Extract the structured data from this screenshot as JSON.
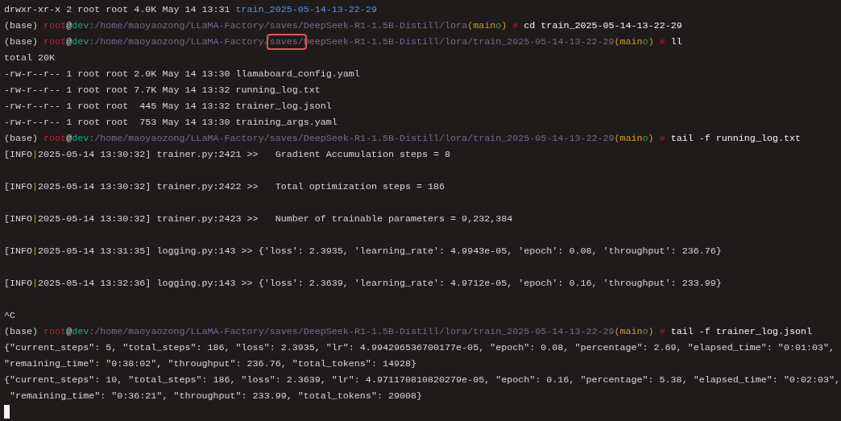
{
  "terminal": {
    "lines": [
      {
        "kind": "text",
        "segments": [
          {
            "text": "drwxr-xr-x 2 root root 4.0K May 14 13:31 ",
            "kind": "plain"
          },
          {
            "text": "train_2025-05-14-13-22-29",
            "kind": "dir"
          }
        ]
      },
      {
        "kind": "prompt",
        "env": "(base)",
        "user": "root",
        "at": "@",
        "host": "dev",
        "path": [
          {
            "text": ":/home/maoyaozong/LLaMA-Factory/saves/DeepSeek-R1-1.5B-Distill/lora",
            "boxed": false
          }
        ],
        "branch_open": "(",
        "branch": "main",
        "branch_mark": "o",
        "branch_close": ")",
        "symbol": "#",
        "command": "cd train_2025-05-14-13-22-29"
      },
      {
        "kind": "prompt",
        "env": "(base)",
        "user": "root",
        "at": "@",
        "host": "dev",
        "path": [
          {
            "text": ":/home/maoyaozong/LLaMA-Factory/",
            "boxed": false
          },
          {
            "text": "saves/",
            "boxed": true
          },
          {
            "text": "DeepSeek-R1-1.5B-Distill/lora/train_2025-05-14-13-22-29",
            "boxed": false
          }
        ],
        "branch_open": "(",
        "branch": "main",
        "branch_mark": "o",
        "branch_close": ")",
        "symbol": "#",
        "command": "ll"
      },
      {
        "kind": "text",
        "segments": [
          {
            "text": "total 20K",
            "kind": "plain"
          }
        ]
      },
      {
        "kind": "text",
        "segments": [
          {
            "text": "-rw-r--r-- 1 root root 2.0K May 14 13:30 llamaboard_config.yaml",
            "kind": "plain"
          }
        ]
      },
      {
        "kind": "text",
        "segments": [
          {
            "text": "-rw-r--r-- 1 root root 7.7K May 14 13:32 running_log.txt",
            "kind": "plain"
          }
        ]
      },
      {
        "kind": "text",
        "segments": [
          {
            "text": "-rw-r--r-- 1 root root  445 May 14 13:32 trainer_log.jsonl",
            "kind": "plain"
          }
        ]
      },
      {
        "kind": "text",
        "segments": [
          {
            "text": "-rw-r--r-- 1 root root  753 May 14 13:30 training_args.yaml",
            "kind": "plain"
          }
        ]
      },
      {
        "kind": "prompt",
        "env": "(base)",
        "user": "root",
        "at": "@",
        "host": "dev",
        "path": [
          {
            "text": ":/home/maoyaozong/LLaMA-Factory/saves/DeepSeek-R1-1.5B-Distill/lora/train_2025-05-14-13-22-29",
            "boxed": false
          }
        ],
        "branch_open": "(",
        "branch": "main",
        "branch_mark": "o",
        "branch_close": ")",
        "symbol": "#",
        "command": "tail -f running_log.txt"
      },
      {
        "kind": "text",
        "segments": [
          {
            "text": "[INFO",
            "kind": "plain"
          },
          {
            "text": "|",
            "kind": "accent"
          },
          {
            "text": "2025-05-14 13:30:32] trainer.py:2421 >>   Gradient Accumulation steps = 8",
            "kind": "plain"
          }
        ]
      },
      {
        "kind": "blank"
      },
      {
        "kind": "text",
        "segments": [
          {
            "text": "[INFO",
            "kind": "plain"
          },
          {
            "text": "|",
            "kind": "accent"
          },
          {
            "text": "2025-05-14 13:30:32] trainer.py:2422 >>   Total optimization steps = 186",
            "kind": "plain"
          }
        ]
      },
      {
        "kind": "blank"
      },
      {
        "kind": "text",
        "segments": [
          {
            "text": "[INFO",
            "kind": "plain"
          },
          {
            "text": "|",
            "kind": "accent"
          },
          {
            "text": "2025-05-14 13:30:32] trainer.py:2423 >>   Number of trainable parameters = 9,232,384",
            "kind": "plain"
          }
        ]
      },
      {
        "kind": "blank"
      },
      {
        "kind": "text",
        "segments": [
          {
            "text": "[INFO",
            "kind": "plain"
          },
          {
            "text": "|",
            "kind": "accent"
          },
          {
            "text": "2025-05-14 13:31:35] logging.py:143 >> {'loss': 2.3935, 'learning_rate': 4.9943e-05, 'epoch': 0.08, 'throughput': 236.76}",
            "kind": "plain"
          }
        ]
      },
      {
        "kind": "blank"
      },
      {
        "kind": "text",
        "segments": [
          {
            "text": "[INFO",
            "kind": "plain"
          },
          {
            "text": "|",
            "kind": "accent"
          },
          {
            "text": "2025-05-14 13:32:36] logging.py:143 >> {'loss': 2.3639, 'learning_rate': 4.9712e-05, 'epoch': 0.16, 'throughput': 233.99}",
            "kind": "plain"
          }
        ]
      },
      {
        "kind": "blank"
      },
      {
        "kind": "text",
        "segments": [
          {
            "text": "^C",
            "kind": "plain"
          }
        ]
      },
      {
        "kind": "prompt",
        "env": "(base)",
        "user": "root",
        "at": "@",
        "host": "dev",
        "path": [
          {
            "text": ":/home/maoyaozong/LLaMA-Factory/saves/DeepSeek-R1-1.5B-Distill/lora/train_2025-05-14-13-22-29",
            "boxed": false
          }
        ],
        "branch_open": "(",
        "branch": "main",
        "branch_mark": "o",
        "branch_close": ")",
        "symbol": "#",
        "command": "tail -f trainer_log.jsonl"
      },
      {
        "kind": "text",
        "segments": [
          {
            "text": "{\"current_steps\": 5, \"total_steps\": 186, \"loss\": 2.3935, \"lr\": 4.994296536700177e-05, \"epoch\": 0.08, \"percentage\": 2.69, \"elapsed_time\": \"0:01:03\",",
            "kind": "plain"
          }
        ]
      },
      {
        "kind": "text",
        "segments": [
          {
            "text": "\"remaining_time\": \"0:38:02\", \"throughput\": 236.76, \"total_tokens\": 14928}",
            "kind": "plain"
          }
        ]
      },
      {
        "kind": "text",
        "segments": [
          {
            "text": "{\"current_steps\": 10, \"total_steps\": 186, \"loss\": 2.3639, \"lr\": 4.971170810820279e-05, \"epoch\": 0.16, \"percentage\": 5.38, \"elapsed_time\": \"0:02:03\",",
            "kind": "plain"
          }
        ]
      },
      {
        "kind": "text",
        "segments": [
          {
            "text": " \"remaining_time\": \"0:36:21\", \"throughput\": 233.99, \"total_tokens\": 29008}",
            "kind": "plain"
          }
        ]
      },
      {
        "kind": "cursor"
      }
    ]
  }
}
